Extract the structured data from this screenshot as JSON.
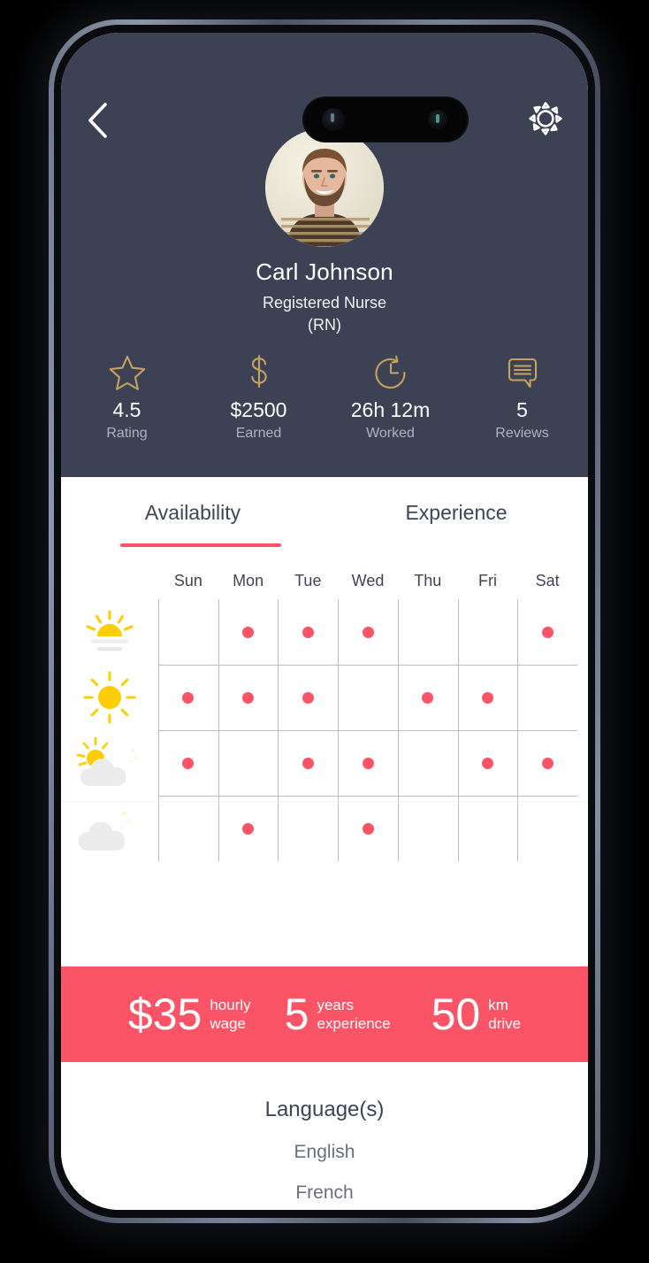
{
  "header": {
    "back_icon": "chevron-left-icon",
    "settings_icon": "gear-icon",
    "avatar_icon": "profile-photo",
    "name": "Carl Johnson",
    "role_line1": "Registered Nurse",
    "role_line2": "(RN)",
    "accent_gold": "#c6a161",
    "background": "#3c4254",
    "stats": [
      {
        "icon": "star-icon",
        "value": "4.5",
        "label": "Rating"
      },
      {
        "icon": "dollar-icon",
        "value": "$2500",
        "label": "Earned"
      },
      {
        "icon": "clock-refresh-icon",
        "value": "26h 12m",
        "label": "Worked"
      },
      {
        "icon": "speech-bubble-icon",
        "value": "5",
        "label": "Reviews"
      }
    ]
  },
  "tabs": [
    {
      "label": "Availability",
      "active": true
    },
    {
      "label": "Experience",
      "active": false
    }
  ],
  "availability": {
    "days": [
      "Sun",
      "Mon",
      "Tue",
      "Wed",
      "Thu",
      "Fri",
      "Sat"
    ],
    "dot_color": "#fb5467",
    "rows": [
      {
        "icon": "sunrise-icon",
        "period": "morning",
        "dots": [
          false,
          true,
          true,
          true,
          false,
          false,
          true
        ]
      },
      {
        "icon": "sun-icon",
        "period": "day",
        "dots": [
          true,
          true,
          true,
          false,
          true,
          true,
          false
        ]
      },
      {
        "icon": "sun-moon-cloud-icon",
        "period": "evening",
        "dots": [
          true,
          false,
          true,
          true,
          false,
          true,
          true
        ]
      },
      {
        "icon": "moon-cloud-icon",
        "period": "night",
        "dots": [
          false,
          true,
          false,
          true,
          false,
          false,
          false
        ]
      }
    ]
  },
  "banner": {
    "background": "#fb5467",
    "items": [
      {
        "value": "$35",
        "unit_line1": "hourly",
        "unit_line2": "wage"
      },
      {
        "value": "5",
        "unit_line1": "years",
        "unit_line2": "experience"
      },
      {
        "value": "50",
        "unit_line1": "km",
        "unit_line2": "drive"
      }
    ]
  },
  "languages": {
    "title": "Language(s)",
    "items": [
      "English",
      "French"
    ]
  }
}
